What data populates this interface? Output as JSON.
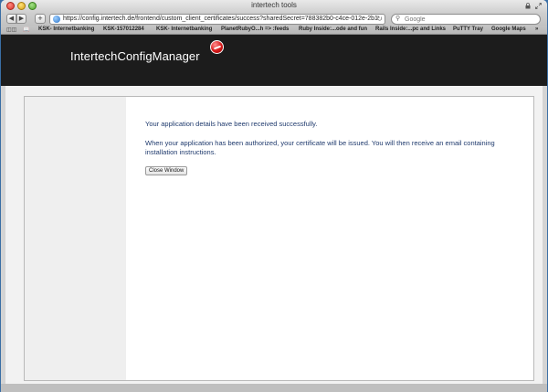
{
  "window": {
    "title": "intertech tools"
  },
  "toolbar": {
    "back_icon": "◀",
    "forward_icon": "▶",
    "add_icon": "+",
    "url": "https://config.intertech.de/frontend/custom_client_certificates/success?sharedSecret=788382b0-c4ce-012e-2b1",
    "reload_icon": "↻",
    "search_placeholder": "Google"
  },
  "bookmarks": {
    "items": [
      "KSK- Internetbanking",
      "KSK-157012284",
      "KSK- Internetbanking",
      "PlanetRubyO...h => :feeds",
      "Ruby Inside:...ode and fun",
      "Rails Inside:...pc and Links",
      "PuTTY Tray",
      "Google Maps"
    ],
    "overflow_icon": "»"
  },
  "header": {
    "logo_text": "IntertechConfigManager"
  },
  "content": {
    "message_line1": "Your application details have been received successfully.",
    "message_line2": "When your application has been authorized, your certificate will be issued. You will then receive an email containing installation instructions.",
    "close_button": "Close Window"
  },
  "colors": {
    "header_bg": "#1c1c1c",
    "text_blue": "#1f3a6d",
    "logo_red": "#d61a1a"
  }
}
